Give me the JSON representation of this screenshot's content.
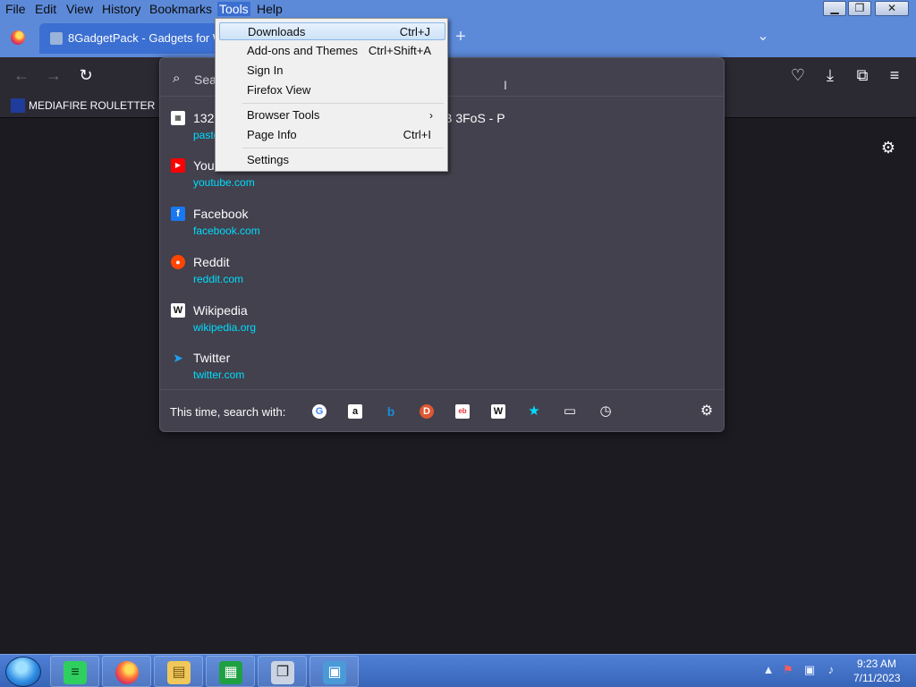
{
  "menubar": {
    "items": [
      "File",
      "Edit",
      "View",
      "History",
      "Bookmarks",
      "Tools",
      "Help"
    ],
    "active": "Tools"
  },
  "window_controls": {
    "minimize": "▁",
    "maximize": "❐",
    "close": "✕"
  },
  "tabs": {
    "active_title": "8GadgetPack - Gadgets for Windows",
    "new_tab_glyph": "+",
    "list_glyph": "⌄"
  },
  "bookmarks_bar": {
    "item": {
      "label": "MEDIAFIRE ROULETTER",
      "favicon_text": "MF T"
    }
  },
  "urlbar": {
    "placeholder": "Search or enter address",
    "results": [
      {
        "title": "132 ... KJxt rhx6 7Rrw UFYR pCa2 i7WF cgdB 3FoS - P",
        "url": "pastebin.com",
        "icon": "pastebin-icon",
        "icon_color": "#ffffff"
      },
      {
        "title": "YouTube",
        "url": "youtube.com",
        "icon": "youtube-icon",
        "icon_color": "#ff0000"
      },
      {
        "title": "Facebook",
        "url": "facebook.com",
        "icon": "facebook-icon",
        "icon_color": "#1877f2"
      },
      {
        "title": "Reddit",
        "url": "reddit.com",
        "icon": "reddit-icon",
        "icon_color": "#ff4500"
      },
      {
        "title": "Wikipedia",
        "url": "wikipedia.org",
        "icon": "wikipedia-icon",
        "icon_color": "#ffffff"
      },
      {
        "title": "Twitter",
        "url": "twitter.com",
        "icon": "twitter-icon",
        "icon_color": "#1da1f2"
      }
    ],
    "search_with_label": "This time, search with:",
    "engines": [
      {
        "name": "google-icon",
        "glyph": "G",
        "bg": "#ffffff",
        "fg": "#4285f4"
      },
      {
        "name": "amazon-icon",
        "glyph": "a",
        "bg": "#ffffff",
        "fg": "#111111"
      },
      {
        "name": "bing-icon",
        "glyph": "b",
        "bg": "transparent",
        "fg": "#1c8ad9"
      },
      {
        "name": "duckduckgo-icon",
        "glyph": "D",
        "bg": "#de5833",
        "fg": "#ffffff"
      },
      {
        "name": "ebay-icon",
        "glyph": "eb",
        "bg": "#ffffff",
        "fg": "#e53238"
      },
      {
        "name": "wikipedia-icon",
        "glyph": "W",
        "bg": "#ffffff",
        "fg": "#111111"
      },
      {
        "name": "bookmarks-star-icon",
        "glyph": "★",
        "bg": "transparent",
        "fg": "#00ddff"
      },
      {
        "name": "tabs-icon",
        "glyph": "▭",
        "bg": "transparent",
        "fg": "#fbfbfe"
      },
      {
        "name": "history-icon",
        "glyph": "◷",
        "bg": "transparent",
        "fg": "#fbfbfe"
      }
    ]
  },
  "tools_menu": {
    "items": [
      {
        "label": "Downloads",
        "accel": "Ctrl+J",
        "highlighted": true
      },
      {
        "label": "Add-ons and Themes",
        "accel": "Ctrl+Shift+A"
      },
      {
        "label": "Sign In",
        "accel": ""
      },
      {
        "label": "Firefox View",
        "accel": ""
      },
      {
        "label": "Browser Tools",
        "accel": "",
        "submenu": true
      },
      {
        "label": "Page Info",
        "accel": "Ctrl+I"
      },
      {
        "label": "Settings",
        "accel": ""
      }
    ]
  },
  "taskbar": {
    "clock_time": "9:23 AM",
    "clock_date": "7/11/2023"
  }
}
